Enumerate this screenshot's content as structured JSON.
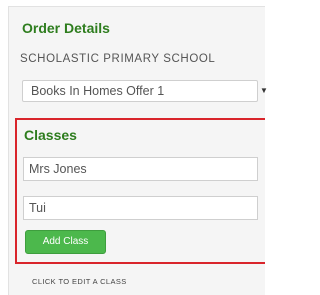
{
  "order_details": {
    "title": "Order Details",
    "school_name": "SCHOLASTIC PRIMARY SCHOOL",
    "offer_select": {
      "value": "Books In Homes Offer 1",
      "caret": "▼"
    }
  },
  "classes": {
    "title": "Classes",
    "items": [
      "Mrs Jones",
      "Tui"
    ],
    "add_button_label": "Add Class",
    "edit_hint": "CLICK TO EDIT A CLASS",
    "highlight_color": "#d9252b"
  },
  "colors": {
    "heading": "#2e7d1e",
    "button": "#4cb84c"
  }
}
